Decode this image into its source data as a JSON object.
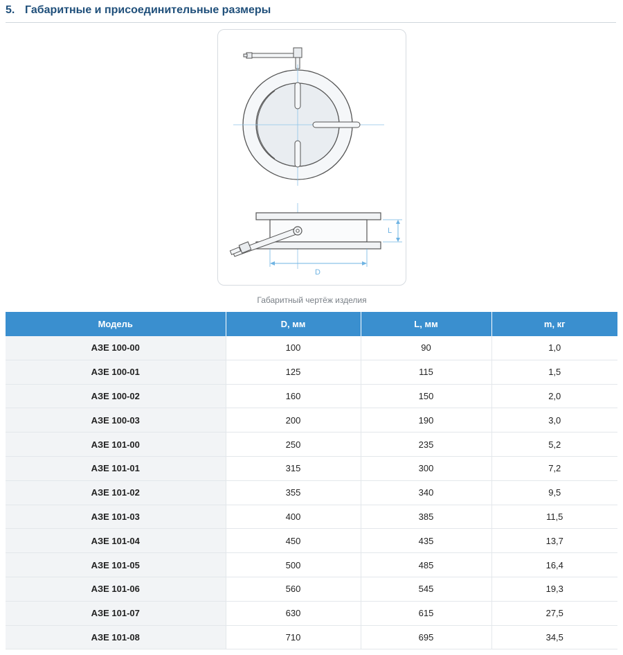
{
  "section": {
    "number": "5.",
    "title": "Габаритные и присоединительные размеры"
  },
  "drawing": {
    "label_l": "L",
    "label_d": "D",
    "caption": "Габаритный чертёж изделия"
  },
  "table": {
    "headers": [
      "Модель",
      "D, мм",
      "L, мм",
      "m, кг"
    ],
    "rows": [
      [
        "АЗЕ 100-00",
        "100",
        "90",
        "1,0"
      ],
      [
        "АЗЕ 100-01",
        "125",
        "115",
        "1,5"
      ],
      [
        "АЗЕ 100-02",
        "160",
        "150",
        "2,0"
      ],
      [
        "АЗЕ 100-03",
        "200",
        "190",
        "3,0"
      ],
      [
        "АЗЕ 101-00",
        "250",
        "235",
        "5,2"
      ],
      [
        "АЗЕ 101-01",
        "315",
        "300",
        "7,2"
      ],
      [
        "АЗЕ 101-02",
        "355",
        "340",
        "9,5"
      ],
      [
        "АЗЕ 101-03",
        "400",
        "385",
        "11,5"
      ],
      [
        "АЗЕ 101-04",
        "450",
        "435",
        "13,7"
      ],
      [
        "АЗЕ 101-05",
        "500",
        "485",
        "16,4"
      ],
      [
        "АЗЕ 101-06",
        "560",
        "545",
        "19,3"
      ],
      [
        "АЗЕ 101-07",
        "630",
        "615",
        "27,5"
      ],
      [
        "АЗЕ 101-08",
        "710",
        "695",
        "34,5"
      ]
    ]
  },
  "colors": {
    "header_bg": "#3a8fcf",
    "title": "#1f4f7a",
    "dimension_line": "#6fb4e3"
  }
}
